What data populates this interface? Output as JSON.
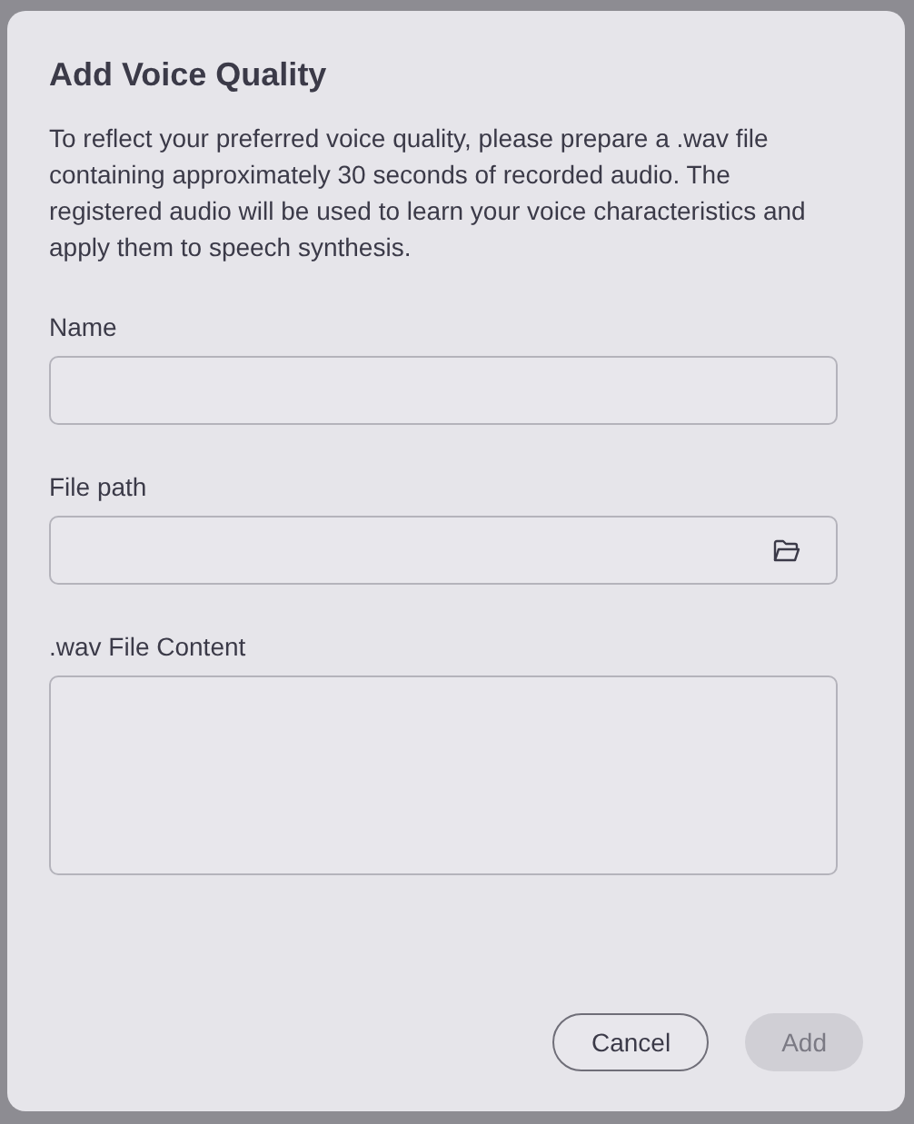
{
  "dialog": {
    "title": "Add Voice Quality",
    "description": "To reflect your preferred voice quality, please prepare a .wav file containing approximately 30 seconds of recorded audio. The registered audio will be used to learn your voice characteristics and apply them to speech synthesis.",
    "fields": [
      {
        "label": "Name",
        "kind": "text"
      },
      {
        "label": "File path",
        "kind": "file"
      },
      {
        "label": ".wav File Content",
        "kind": "textarea"
      }
    ],
    "buttons": [
      {
        "label": "Cancel",
        "disabled": false
      },
      {
        "label": "Add",
        "disabled": true
      }
    ]
  }
}
